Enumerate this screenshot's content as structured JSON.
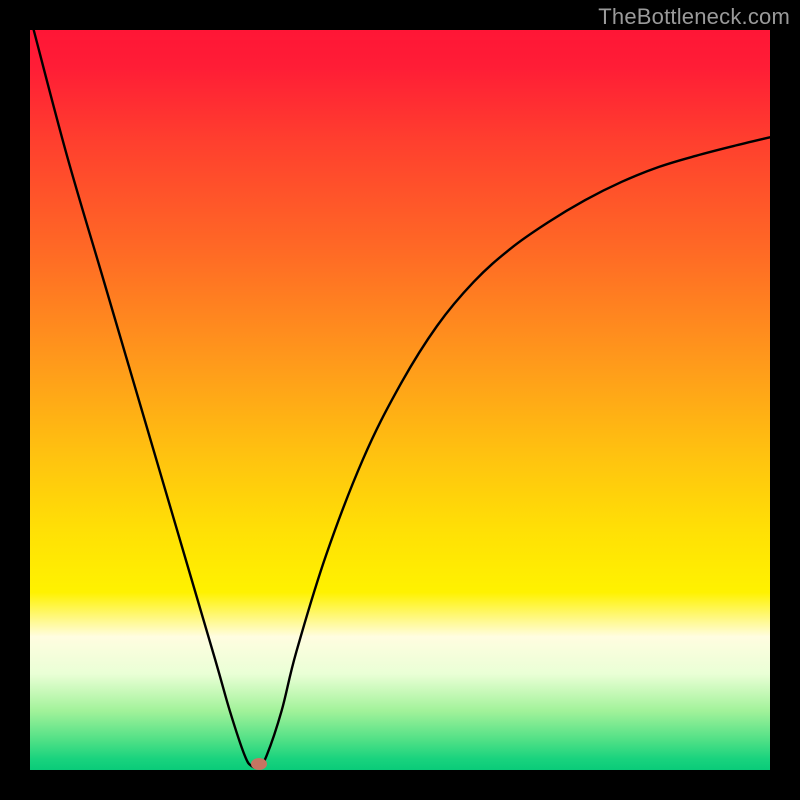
{
  "watermark": "TheBottleneck.com",
  "chart_data": {
    "type": "line",
    "title": "",
    "xlabel": "",
    "ylabel": "",
    "xlim": [
      0,
      100
    ],
    "ylim": [
      0,
      100
    ],
    "grid": false,
    "legend": false,
    "gradient_stops": [
      {
        "pct": 0,
        "color": "#ff1636"
      },
      {
        "pct": 5,
        "color": "#ff1d36"
      },
      {
        "pct": 15,
        "color": "#ff3f2e"
      },
      {
        "pct": 30,
        "color": "#ff6a25"
      },
      {
        "pct": 45,
        "color": "#ff9a1b"
      },
      {
        "pct": 58,
        "color": "#ffc40f"
      },
      {
        "pct": 68,
        "color": "#ffe105"
      },
      {
        "pct": 76,
        "color": "#fff200"
      },
      {
        "pct": 82,
        "color": "#fffde0"
      },
      {
        "pct": 87,
        "color": "#eaffd6"
      },
      {
        "pct": 92,
        "color": "#a2f29a"
      },
      {
        "pct": 96,
        "color": "#4fe086"
      },
      {
        "pct": 98.5,
        "color": "#19d37e"
      },
      {
        "pct": 100,
        "color": "#0acb79"
      }
    ],
    "series": [
      {
        "name": "curve",
        "x": [
          0.5,
          5,
          10,
          15,
          20,
          25,
          27,
          29,
          30,
          31,
          32,
          34,
          36,
          40,
          45,
          50,
          55,
          60,
          65,
          70,
          75,
          80,
          85,
          90,
          95,
          100
        ],
        "y": [
          100,
          83,
          66,
          49,
          32,
          15,
          8,
          2,
          0.5,
          0.5,
          2,
          8,
          16,
          29,
          42,
          52,
          60,
          66,
          70.5,
          74,
          77,
          79.5,
          81.5,
          83,
          84.3,
          85.5
        ]
      }
    ],
    "marker": {
      "x": 31,
      "y": 0.8,
      "color": "#c67562"
    }
  }
}
